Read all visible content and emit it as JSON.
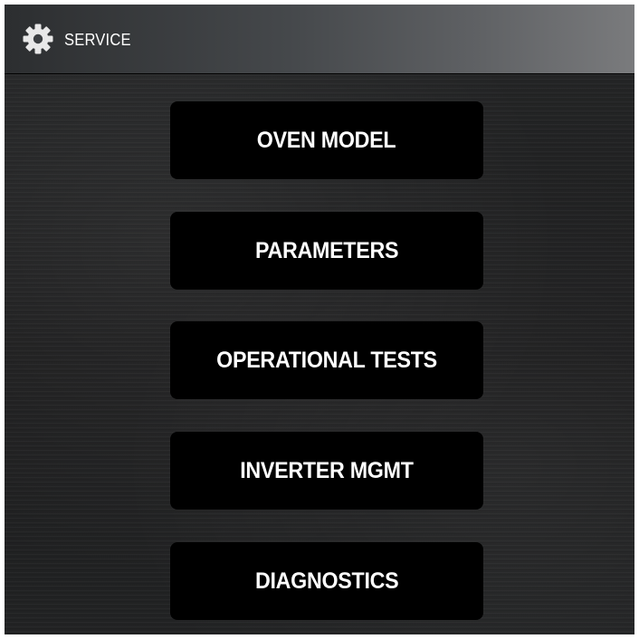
{
  "header": {
    "icon": "gear-icon",
    "title": "SERVICE"
  },
  "menu": {
    "items": [
      {
        "label": "OVEN MODEL"
      },
      {
        "label": "PARAMETERS"
      },
      {
        "label": "OPERATIONAL TESTS"
      },
      {
        "label": "INVERTER MGMT"
      },
      {
        "label": "DIAGNOSTICS"
      }
    ]
  },
  "colors": {
    "button_bg": "#000000",
    "text": "#ffffff",
    "background": "#1d1d1e"
  }
}
